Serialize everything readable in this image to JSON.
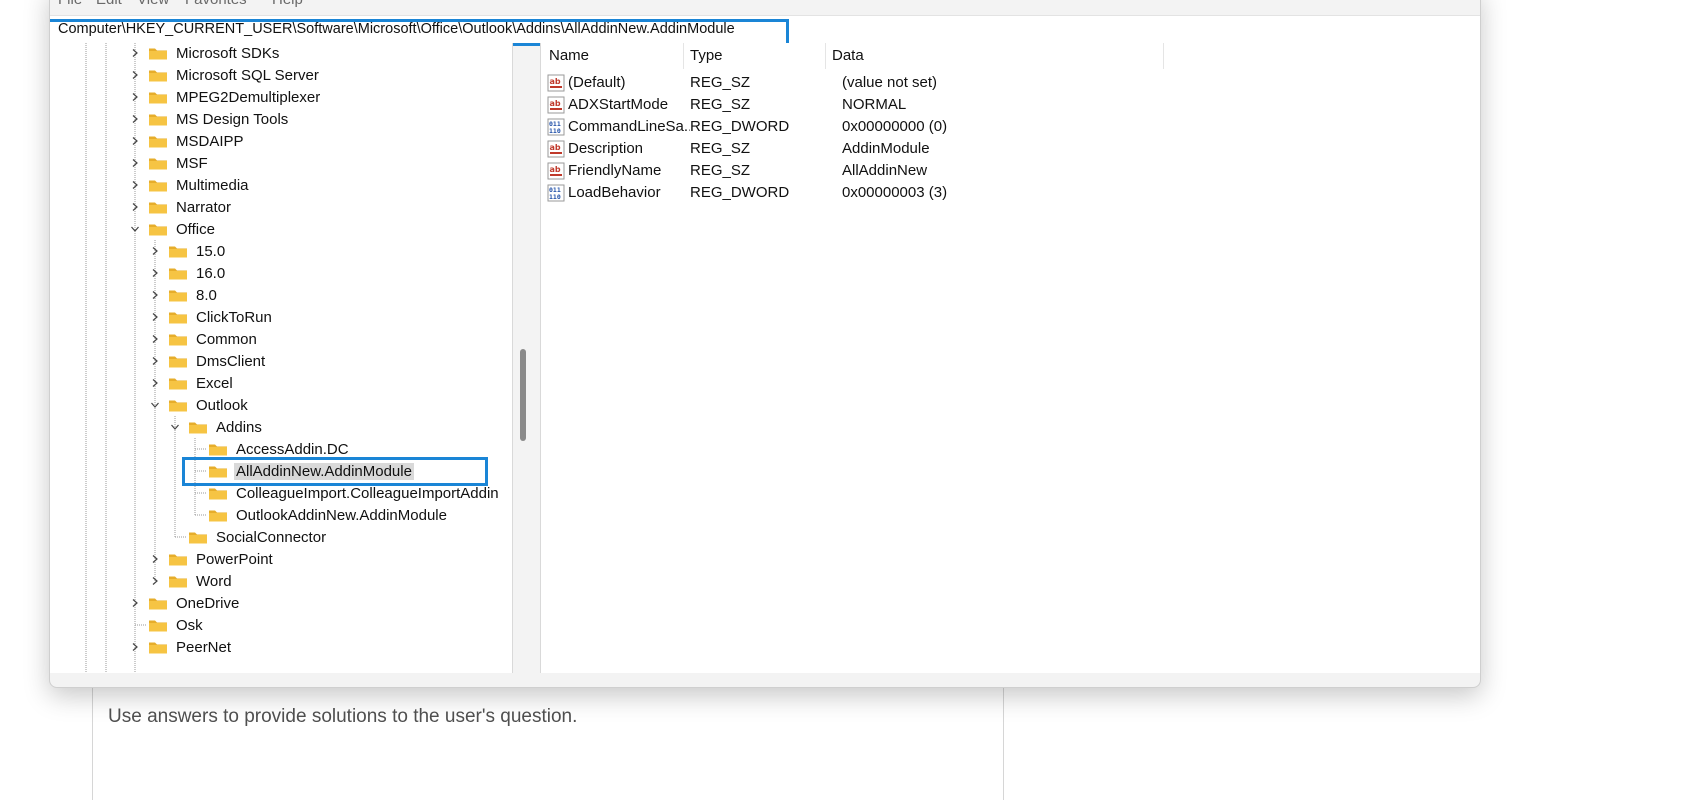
{
  "menu": [
    "File",
    "Edit",
    "View",
    "Favorites",
    "Help"
  ],
  "address": "Computer\\HKEY_CURRENT_USER\\Software\\Microsoft\\Office\\Outlook\\Addins\\AllAddinNew.AddinModule",
  "tree": [
    {
      "label": "Microsoft SDKs",
      "level": 1,
      "state": "collapsed"
    },
    {
      "label": "Microsoft SQL Server",
      "level": 1,
      "state": "collapsed"
    },
    {
      "label": "MPEG2Demultiplexer",
      "level": 1,
      "state": "collapsed"
    },
    {
      "label": "MS Design Tools",
      "level": 1,
      "state": "collapsed"
    },
    {
      "label": "MSDAIPP",
      "level": 1,
      "state": "collapsed"
    },
    {
      "label": "MSF",
      "level": 1,
      "state": "collapsed"
    },
    {
      "label": "Multimedia",
      "level": 1,
      "state": "collapsed"
    },
    {
      "label": "Narrator",
      "level": 1,
      "state": "collapsed"
    },
    {
      "label": "Office",
      "level": 1,
      "state": "expanded"
    },
    {
      "label": "15.0",
      "level": 2,
      "state": "collapsed"
    },
    {
      "label": "16.0",
      "level": 2,
      "state": "collapsed"
    },
    {
      "label": "8.0",
      "level": 2,
      "state": "collapsed"
    },
    {
      "label": "ClickToRun",
      "level": 2,
      "state": "collapsed"
    },
    {
      "label": "Common",
      "level": 2,
      "state": "collapsed"
    },
    {
      "label": "DmsClient",
      "level": 2,
      "state": "collapsed"
    },
    {
      "label": "Excel",
      "level": 2,
      "state": "collapsed"
    },
    {
      "label": "Outlook",
      "level": 2,
      "state": "expanded"
    },
    {
      "label": "Addins",
      "level": 3,
      "state": "expanded"
    },
    {
      "label": "AccessAddin.DC",
      "level": 4,
      "state": "leaf"
    },
    {
      "label": "AllAddinNew.AddinModule",
      "level": 4,
      "state": "leaf",
      "selected": true
    },
    {
      "label": "ColleagueImport.ColleagueImportAddin",
      "level": 4,
      "state": "leaf"
    },
    {
      "label": "OutlookAddinNew.AddinModule",
      "level": 4,
      "state": "leaf"
    },
    {
      "label": "SocialConnector",
      "level": 3,
      "state": "leaf"
    },
    {
      "label": "PowerPoint",
      "level": 2,
      "state": "collapsed"
    },
    {
      "label": "Word",
      "level": 2,
      "state": "collapsed"
    },
    {
      "label": "OneDrive",
      "level": 1,
      "state": "collapsed"
    },
    {
      "label": "Osk",
      "level": 1,
      "state": "leaf"
    },
    {
      "label": "PeerNet",
      "level": 1,
      "state": "collapsed"
    }
  ],
  "columns": {
    "name": "Name",
    "type": "Type",
    "data": "Data"
  },
  "values": [
    {
      "icon": "string-value-icon",
      "name": "(Default)",
      "type": "REG_SZ",
      "data": "(value not set)"
    },
    {
      "icon": "string-value-icon",
      "name": "ADXStartMode",
      "type": "REG_SZ",
      "data": "NORMAL"
    },
    {
      "icon": "binary-value-icon",
      "name": "CommandLineSa...",
      "type": "REG_DWORD",
      "data": "0x00000000 (0)"
    },
    {
      "icon": "string-value-icon",
      "name": "Description",
      "type": "REG_SZ",
      "data": "AddinModule"
    },
    {
      "icon": "string-value-icon",
      "name": "FriendlyName",
      "type": "REG_SZ",
      "data": "AllAddinNew"
    },
    {
      "icon": "binary-value-icon",
      "name": "LoadBehavior",
      "type": "REG_DWORD",
      "data": "0x00000003 (3)"
    }
  ],
  "background_text": "Use answers to provide solutions to the user's question.",
  "colors": {
    "highlight": "#1a85d6",
    "folder": "#f6c443",
    "selected_bg": "#d9d9d9"
  }
}
